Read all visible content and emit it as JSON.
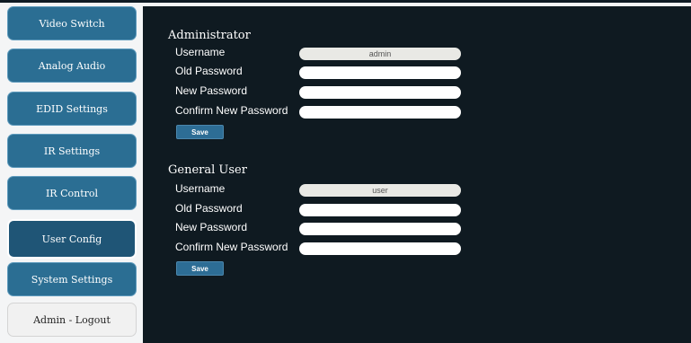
{
  "sidebar": {
    "items": [
      {
        "label": "Video Switch"
      },
      {
        "label": "Analog Audio"
      },
      {
        "label": "EDID Settings"
      },
      {
        "label": "IR Settings"
      },
      {
        "label": "IR Control"
      },
      {
        "label": "User Config"
      },
      {
        "label": "System Settings"
      },
      {
        "label": "Admin - Logout"
      }
    ],
    "active": "User Config"
  },
  "admin": {
    "title": "Administrator",
    "username_label": "Username",
    "username_value": "admin",
    "old_password_label": "Old Password",
    "old_password_value": "",
    "new_password_label": "New Password",
    "new_password_value": "",
    "confirm_password_label": "Confirm New Password",
    "confirm_password_value": "",
    "save_label": "Save"
  },
  "user": {
    "title": "General User",
    "username_label": "Username",
    "username_value": "user",
    "old_password_label": "Old Password",
    "old_password_value": "",
    "new_password_label": "New Password",
    "new_password_value": "",
    "confirm_password_label": "Confirm New Password",
    "confirm_password_value": "",
    "save_label": "Save"
  },
  "colors": {
    "sidebar_button": "#2b6e93",
    "active_border": "#ffffff",
    "panel_background": "#0f1a21",
    "save_button": "#2d6d95"
  }
}
